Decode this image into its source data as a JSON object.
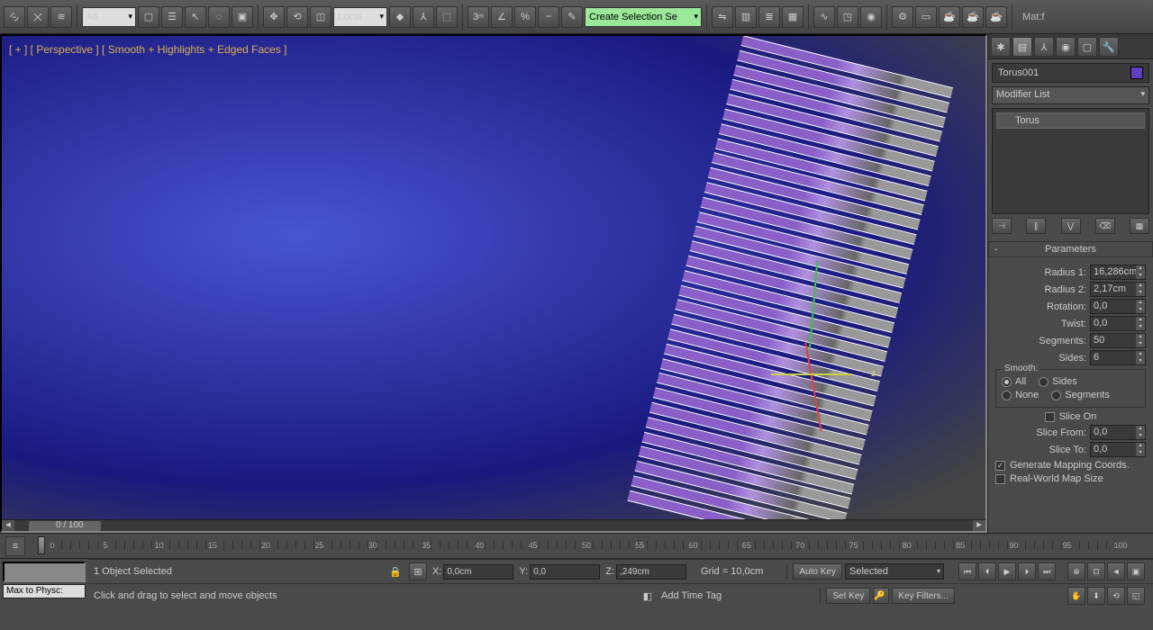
{
  "toolbar": {
    "filter_all": "All",
    "coord_sys": "Local",
    "named_sel": "Create Selection Se",
    "mat_label": "Mat:f"
  },
  "viewport": {
    "label": "[ + ] [ Perspective ] [ Smooth + Highlights + Edged Faces ]",
    "frame": "0 / 100",
    "gizmo_z": "z"
  },
  "panel": {
    "object_name": "Torus001",
    "modifier_list": "Modifier List",
    "modifier_item": "Torus"
  },
  "params": {
    "title": "Parameters",
    "radius1_label": "Radius 1:",
    "radius1": "16,286cm",
    "radius2_label": "Radius 2:",
    "radius2": "2,17cm",
    "rotation_label": "Rotation:",
    "rotation": "0,0",
    "twist_label": "Twist:",
    "twist": "0,0",
    "segments_label": "Segments:",
    "segments": "50",
    "sides_label": "Sides:",
    "sides": "6",
    "smooth_title": "Smooth:",
    "smooth_all": "All",
    "smooth_sides": "Sides",
    "smooth_none": "None",
    "smooth_segments": "Segments",
    "slice_on": "Slice On",
    "slice_from_label": "Slice From:",
    "slice_from": "0,0",
    "slice_to_label": "Slice To:",
    "slice_to": "0,0",
    "gen_mapping": "Generate Mapping Coords.",
    "real_world": "Real-World Map Size"
  },
  "timeline": {
    "ticks": [
      0,
      5,
      10,
      15,
      20,
      25,
      30,
      35,
      40,
      45,
      50,
      55,
      60,
      65,
      70,
      75,
      80,
      85,
      90,
      95,
      100
    ]
  },
  "status": {
    "selected": "1 Object Selected",
    "hint": "Click and drag to select and move objects",
    "x_label": "X:",
    "x": "0,0cm",
    "y_label": "Y:",
    "y": "0,0",
    "z_label": "Z:",
    "z": ",249cm",
    "grid": "Grid = 10,0cm",
    "add_tag": "Add Time Tag",
    "maxscript": "Max to Physc:",
    "auto_key": "Auto Key",
    "set_key": "Set Key",
    "key_mode": "Selected",
    "key_filters": "Key Filters..."
  }
}
